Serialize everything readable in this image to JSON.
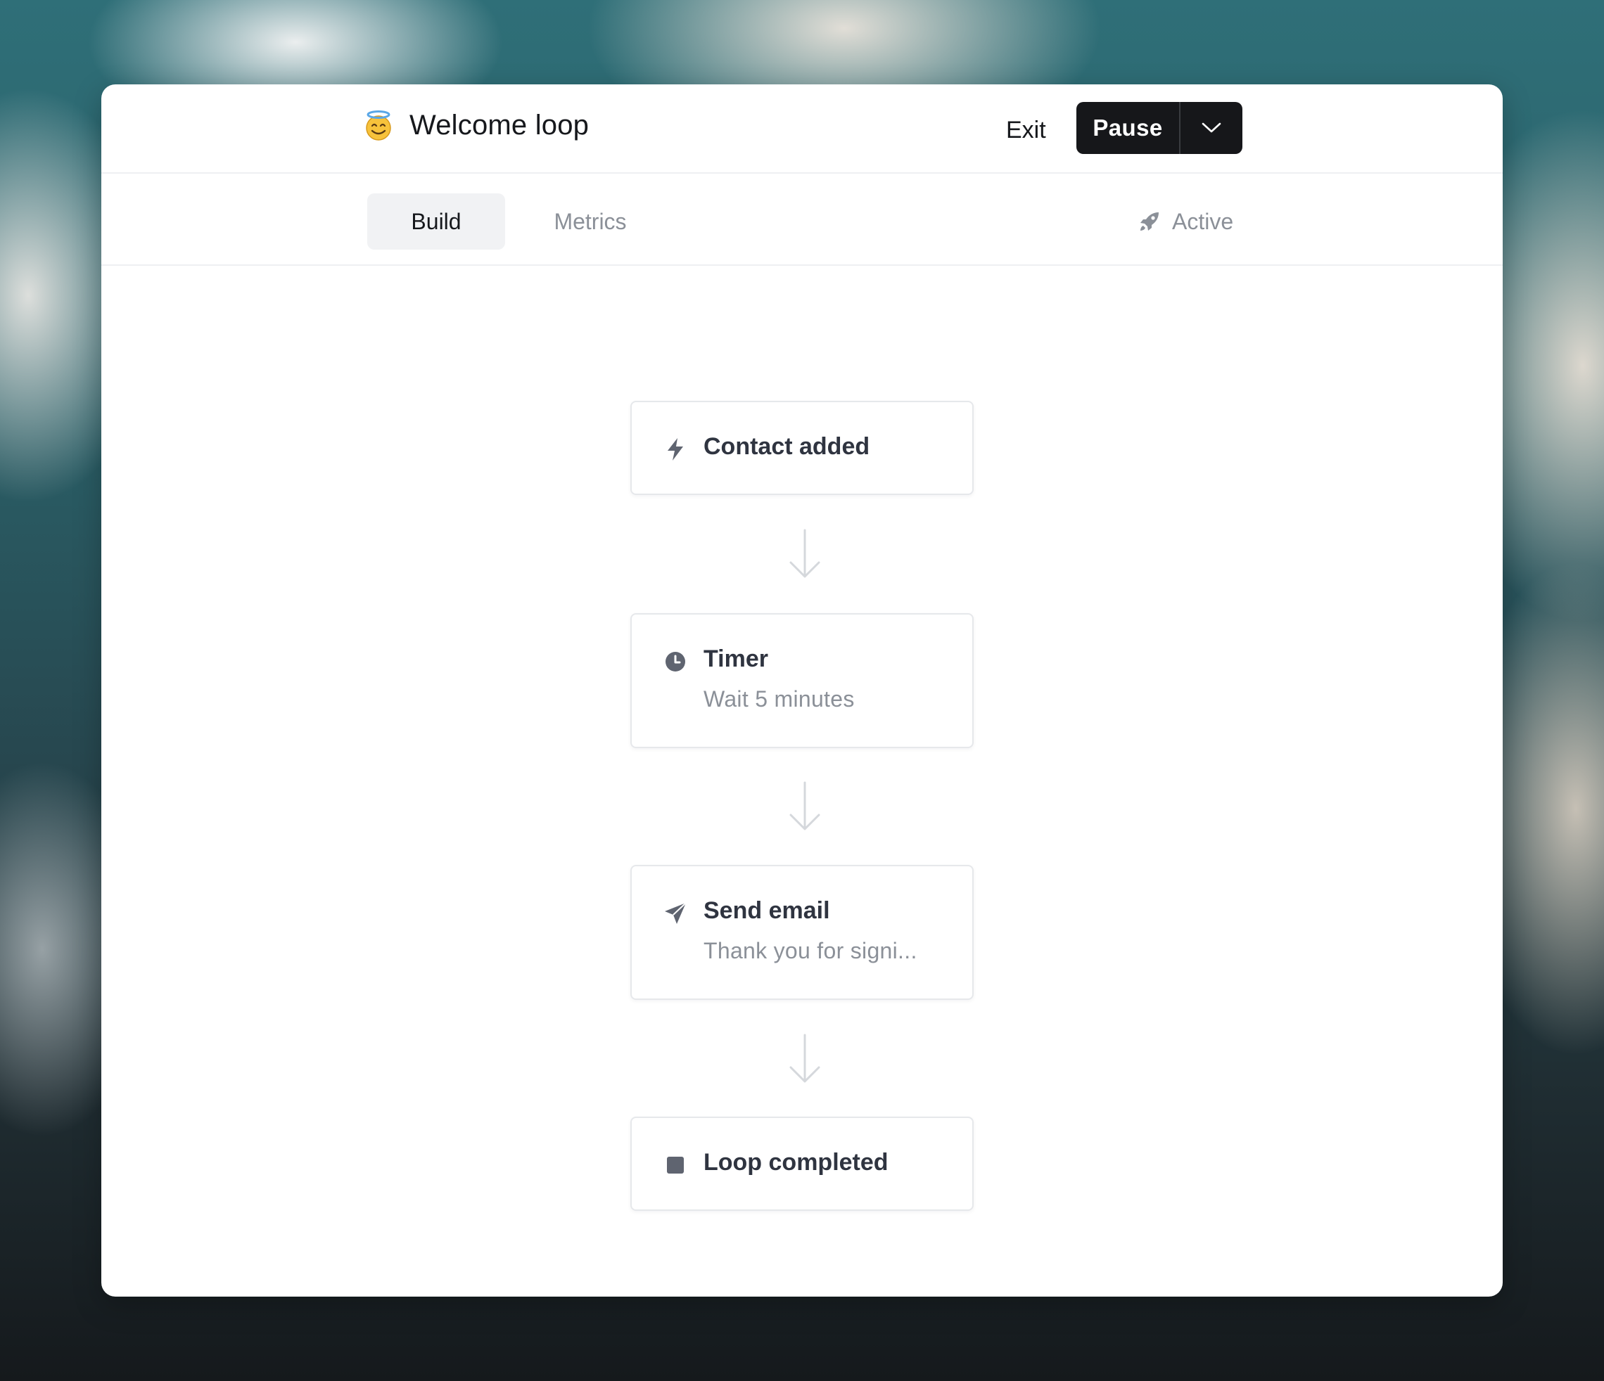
{
  "window": {
    "title": "Welcome loop",
    "emoji_icon": "smiling-face-with-halo-icon"
  },
  "header": {
    "exit_label": "Exit",
    "pause_label": "Pause",
    "dropdown_icon": "chevron-down-icon"
  },
  "tabs": [
    {
      "label": "Build",
      "active": true
    },
    {
      "label": "Metrics",
      "active": false
    }
  ],
  "status": {
    "label": "Active",
    "icon": "rocket-icon"
  },
  "flow": {
    "nodes": [
      {
        "icon": "lightning-bolt-icon",
        "title": "Contact added",
        "subtitle": ""
      },
      {
        "icon": "clock-icon",
        "title": "Timer",
        "subtitle": "Wait 5 minutes"
      },
      {
        "icon": "paper-plane-icon",
        "title": "Send email",
        "subtitle": "Thank you for signi..."
      },
      {
        "icon": "stop-square-icon",
        "title": "Loop completed",
        "subtitle": ""
      }
    ]
  },
  "colors": {
    "primary_button": "#16171a",
    "text_primary": "#16181c",
    "text_muted": "#8b9098",
    "node_title": "#2f3440",
    "icon": "#5f6470",
    "arrow": "#d5d8dc",
    "active_tab_bg": "#f1f2f4"
  }
}
